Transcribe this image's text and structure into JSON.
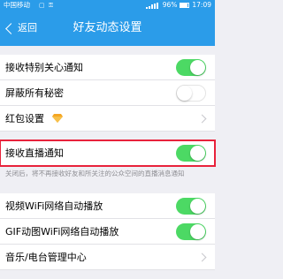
{
  "status_bar": {
    "carrier": "中国移动",
    "carrier_icons": "▢ ⚿",
    "battery_percent": "96%",
    "time": "17:09"
  },
  "nav": {
    "back_label": "返回",
    "title": "好友动态设置"
  },
  "rows": [
    {
      "label": "接收特别关心通知",
      "toggle": "on"
    },
    {
      "label": "屏蔽所有秘密",
      "toggle": "off"
    },
    {
      "label": "红包设置",
      "icon": "diamond-icon",
      "type": "arrow"
    },
    {
      "label": "接收直播通知",
      "toggle": "on",
      "highlighted": true
    },
    {
      "label": "视频WiFi网络自动播放",
      "toggle": "on"
    },
    {
      "label": "GIF动图WiFi网络自动播放",
      "toggle": "on"
    },
    {
      "label": "音乐/电台管理中心",
      "type": "arrow"
    }
  ],
  "live_hint": "关闭后，将不再接收好友和所关注的公众空间的直播消息通知",
  "colors": {
    "header": "#2b9ce9",
    "toggle_on": "#4cd964",
    "highlight": "#e8223b"
  }
}
